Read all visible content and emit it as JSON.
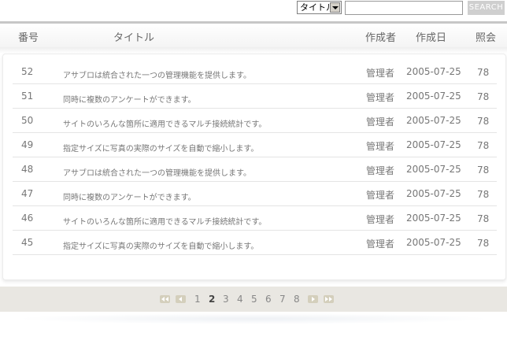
{
  "search": {
    "select_value": "タイトル",
    "input_value": "",
    "button_label": "SEARCH"
  },
  "header": {
    "num": "番号",
    "title": "タイトル",
    "author": "作成者",
    "date": "作成日",
    "views": "照会"
  },
  "rows": [
    {
      "num": "52",
      "title": "アサブロは統合された一つの管理機能を提供します。",
      "author": "管理者",
      "date": "2005-07-25",
      "views": "78"
    },
    {
      "num": "51",
      "title": "同時に複数のアンケートができます。",
      "author": "管理者",
      "date": "2005-07-25",
      "views": "78"
    },
    {
      "num": "50",
      "title": "サイトのいろんな箇所に適用できるマルチ接続統計です。",
      "author": "管理者",
      "date": "2005-07-25",
      "views": "78"
    },
    {
      "num": "49",
      "title": "指定サイズに写真の実際のサイズを自動で縮小します。",
      "author": "管理者",
      "date": "2005-07-25",
      "views": "78"
    },
    {
      "num": "48",
      "title": "アサブロは統合された一つの管理機能を提供します。",
      "author": "管理者",
      "date": "2005-07-25",
      "views": "78"
    },
    {
      "num": "47",
      "title": "同時に複数のアンケートができます。",
      "author": "管理者",
      "date": "2005-07-25",
      "views": "78"
    },
    {
      "num": "46",
      "title": "サイトのいろんな箇所に適用できるマルチ接続統計です。",
      "author": "管理者",
      "date": "2005-07-25",
      "views": "78"
    },
    {
      "num": "45",
      "title": "指定サイズに写真の実際のサイズを自動で縮小します。",
      "author": "管理者",
      "date": "2005-07-25",
      "views": "78"
    }
  ],
  "pagination": {
    "pages": [
      "1",
      "2",
      "3",
      "4",
      "5",
      "6",
      "7",
      "8"
    ],
    "current": "2",
    "icons": [
      "first-page-icon",
      "prev-page-icon",
      "next-page-icon",
      "last-page-icon"
    ]
  }
}
